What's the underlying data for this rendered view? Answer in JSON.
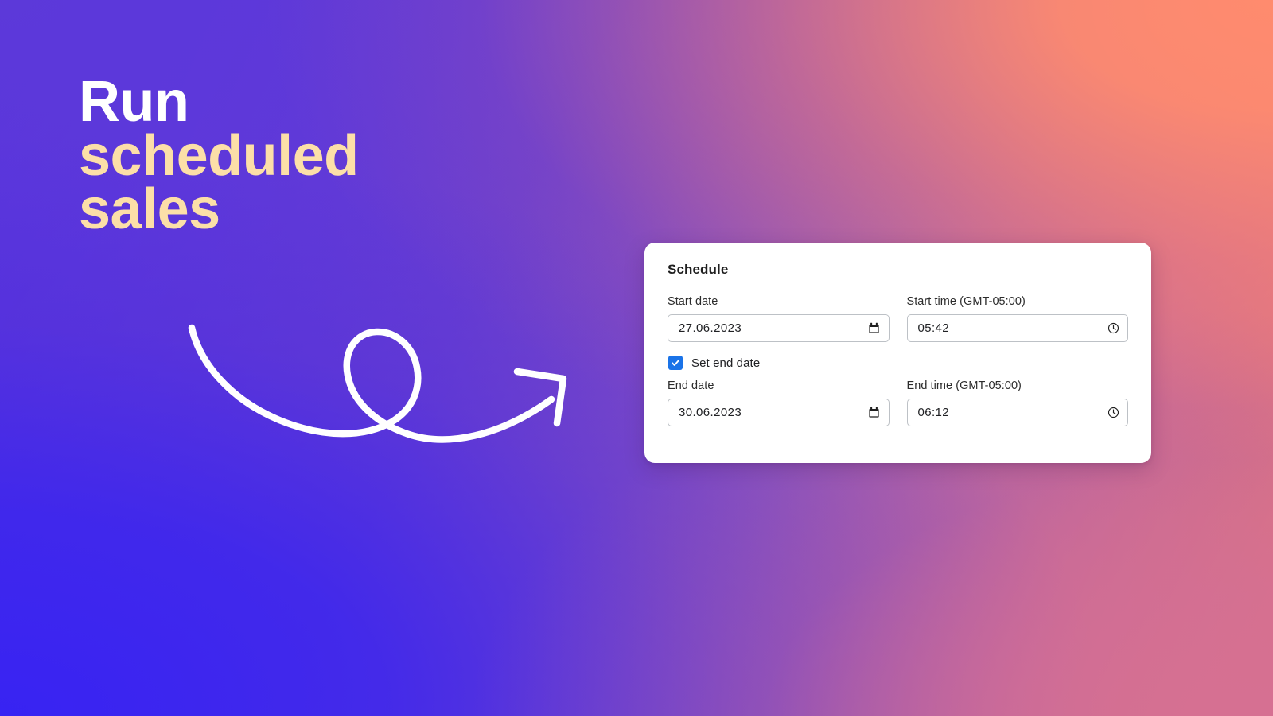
{
  "background": {
    "colors": {
      "top_left": "#5c39d9",
      "top_right": "#fb8469",
      "bottom_left": "#3823f3",
      "bottom_right": "#d67092",
      "mid_purple": "#7c49c4"
    }
  },
  "headline": {
    "lines": [
      {
        "text": "Run",
        "color": "#ffffff"
      },
      {
        "text": "scheduled",
        "color": "#fcdfa8"
      },
      {
        "text": "sales",
        "color": "#fcdfa8"
      }
    ]
  },
  "decoration": {
    "arrow": "curved-loop-arrow",
    "arrow_color": "#ffffff"
  },
  "card": {
    "title": "Schedule",
    "accent_color": "#1a73e8",
    "rows": [
      {
        "fields": [
          {
            "label": "Start date",
            "value": "27.06.2023",
            "placeholder": "dd.mm.yyyy",
            "icon": "calendar-icon",
            "name": "start-date"
          },
          {
            "label": "Start time (GMT-05:00)",
            "value": "05:42",
            "placeholder": "--:--",
            "icon": "clock-icon",
            "name": "start-time"
          }
        ]
      },
      {
        "fields": [
          {
            "label": "End date",
            "value": "30.06.2023",
            "placeholder": "dd.mm.yyyy",
            "icon": "calendar-icon",
            "name": "end-date"
          },
          {
            "label": "End time (GMT-05:00)",
            "value": "06:12",
            "placeholder": "--:--",
            "icon": "clock-icon",
            "name": "end-time"
          }
        ]
      }
    ],
    "checkbox": {
      "label": "Set end date",
      "checked": true,
      "glyph": "✓"
    }
  }
}
